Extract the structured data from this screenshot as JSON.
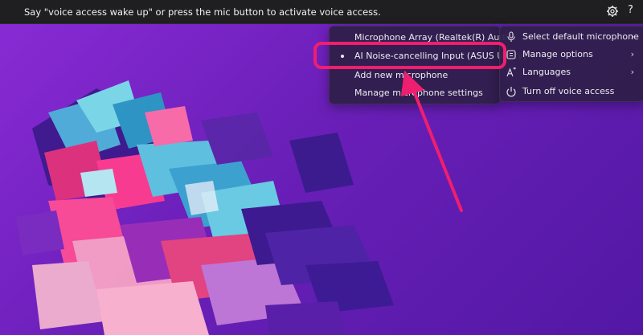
{
  "topbar": {
    "message": "Say \"voice access wake up\" or press the mic button to activate voice access.",
    "help_label": "?"
  },
  "submenu": {
    "items": [
      {
        "label": "Microphone Array (Realtek(R) Audio)",
        "selected": false
      },
      {
        "label": "AI Noise-cancelling Input (ASUS Utility)",
        "selected": true
      },
      {
        "label": "Add new microphone",
        "selected": false
      },
      {
        "label": "Manage microphone settings",
        "selected": false
      }
    ]
  },
  "mainmenu": {
    "items": [
      {
        "label": "Select default microphone",
        "icon": "microphone-icon",
        "chevron": "›"
      },
      {
        "label": "Manage options",
        "icon": "options-icon",
        "chevron": "›"
      },
      {
        "label": "Languages",
        "icon": "languages-icon",
        "chevron": "›"
      },
      {
        "label": "Turn off voice access",
        "icon": "power-icon",
        "chevron": ""
      }
    ]
  },
  "colors": {
    "topbar": "#1f1f22",
    "menu_bg": "#2e1e48",
    "highlight": "#f01e6e",
    "wallpaper_start": "#8a2bd6",
    "wallpaper_end": "#5218a4"
  }
}
